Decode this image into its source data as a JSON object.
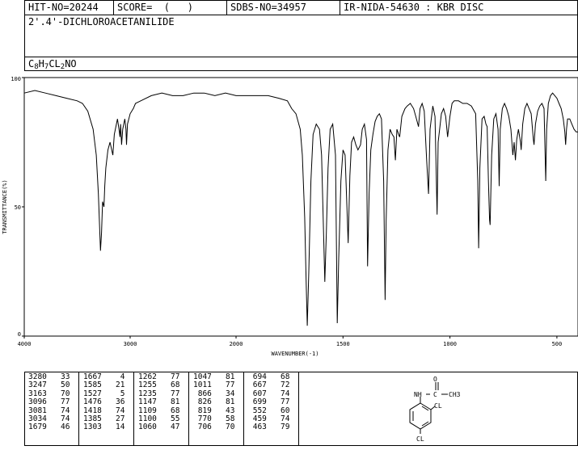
{
  "header": {
    "hit_no": "HIT-NO=20244",
    "score": "SCORE=  (   )",
    "sdbs_no": "SDBS-NO=34957",
    "ir_info": "IR-NIDA-54630 : KBR DISC",
    "compound_name": "2'.4'-DICHLOROACETANILIDE",
    "formula": {
      "c": "C",
      "c_n": "8",
      "h": "H",
      "h_n": "7",
      "cl": "CL",
      "cl_n": "2",
      "rest": "NO"
    }
  },
  "chart_data": {
    "type": "line",
    "xlabel": "WAVENUMBER(-1)",
    "ylabel": "TRANSMITTANCE(%)",
    "xlim": [
      4000,
      400
    ],
    "ylim": [
      0,
      100
    ],
    "x_ticks": [
      "4000",
      "3000",
      "2000",
      "1500",
      "1000",
      "500"
    ],
    "y_ticks": [
      "100",
      "50",
      "0"
    ],
    "series": [
      {
        "points": [
          [
            4000,
            94
          ],
          [
            3900,
            95
          ],
          [
            3800,
            94
          ],
          [
            3700,
            93
          ],
          [
            3600,
            92
          ],
          [
            3500,
            91
          ],
          [
            3450,
            90
          ],
          [
            3400,
            87
          ],
          [
            3350,
            80
          ],
          [
            3320,
            70
          ],
          [
            3300,
            55
          ],
          [
            3290,
            44
          ],
          [
            3280,
            33
          ],
          [
            3270,
            40
          ],
          [
            3260,
            52
          ],
          [
            3247,
            50
          ],
          [
            3240,
            58
          ],
          [
            3230,
            65
          ],
          [
            3210,
            72
          ],
          [
            3190,
            75
          ],
          [
            3163,
            70
          ],
          [
            3150,
            78
          ],
          [
            3130,
            82
          ],
          [
            3120,
            84
          ],
          [
            3105,
            80
          ],
          [
            3096,
            77
          ],
          [
            3090,
            82
          ],
          [
            3081,
            74
          ],
          [
            3070,
            80
          ],
          [
            3050,
            84
          ],
          [
            3040,
            80
          ],
          [
            3034,
            74
          ],
          [
            3025,
            82
          ],
          [
            3000,
            86
          ],
          [
            2970,
            88
          ],
          [
            2950,
            90
          ],
          [
            2900,
            91
          ],
          [
            2800,
            93
          ],
          [
            2700,
            94
          ],
          [
            2600,
            93
          ],
          [
            2500,
            93
          ],
          [
            2400,
            94
          ],
          [
            2300,
            94
          ],
          [
            2200,
            93
          ],
          [
            2100,
            94
          ],
          [
            2000,
            93
          ],
          [
            1950,
            93
          ],
          [
            1900,
            93
          ],
          [
            1850,
            93
          ],
          [
            1800,
            92
          ],
          [
            1760,
            91
          ],
          [
            1740,
            88
          ],
          [
            1720,
            86
          ],
          [
            1700,
            80
          ],
          [
            1690,
            70
          ],
          [
            1679,
            46
          ],
          [
            1672,
            20
          ],
          [
            1667,
            4
          ],
          [
            1660,
            25
          ],
          [
            1650,
            60
          ],
          [
            1640,
            78
          ],
          [
            1625,
            82
          ],
          [
            1610,
            80
          ],
          [
            1600,
            70
          ],
          [
            1585,
            21
          ],
          [
            1578,
            40
          ],
          [
            1570,
            65
          ],
          [
            1560,
            80
          ],
          [
            1548,
            82
          ],
          [
            1535,
            70
          ],
          [
            1527,
            5
          ],
          [
            1520,
            30
          ],
          [
            1510,
            60
          ],
          [
            1500,
            72
          ],
          [
            1490,
            70
          ],
          [
            1476,
            36
          ],
          [
            1468,
            62
          ],
          [
            1460,
            75
          ],
          [
            1450,
            77
          ],
          [
            1440,
            74
          ],
          [
            1430,
            72
          ],
          [
            1418,
            74
          ],
          [
            1410,
            80
          ],
          [
            1400,
            82
          ],
          [
            1390,
            76
          ],
          [
            1385,
            27
          ],
          [
            1378,
            55
          ],
          [
            1370,
            72
          ],
          [
            1360,
            78
          ],
          [
            1350,
            83
          ],
          [
            1340,
            85
          ],
          [
            1330,
            86
          ],
          [
            1320,
            84
          ],
          [
            1310,
            60
          ],
          [
            1303,
            14
          ],
          [
            1298,
            45
          ],
          [
            1290,
            72
          ],
          [
            1280,
            80
          ],
          [
            1270,
            78
          ],
          [
            1262,
            77
          ],
          [
            1255,
            68
          ],
          [
            1248,
            80
          ],
          [
            1240,
            78
          ],
          [
            1235,
            77
          ],
          [
            1225,
            85
          ],
          [
            1210,
            88
          ],
          [
            1200,
            89
          ],
          [
            1185,
            90
          ],
          [
            1170,
            88
          ],
          [
            1160,
            85
          ],
          [
            1147,
            81
          ],
          [
            1140,
            88
          ],
          [
            1130,
            90
          ],
          [
            1120,
            87
          ],
          [
            1109,
            68
          ],
          [
            1100,
            55
          ],
          [
            1093,
            80
          ],
          [
            1080,
            89
          ],
          [
            1070,
            85
          ],
          [
            1060,
            47
          ],
          [
            1055,
            75
          ],
          [
            1047,
            81
          ],
          [
            1040,
            86
          ],
          [
            1030,
            88
          ],
          [
            1020,
            85
          ],
          [
            1011,
            77
          ],
          [
            1000,
            85
          ],
          [
            990,
            90
          ],
          [
            980,
            91
          ],
          [
            960,
            91
          ],
          [
            940,
            90
          ],
          [
            920,
            90
          ],
          [
            900,
            89
          ],
          [
            880,
            86
          ],
          [
            870,
            60
          ],
          [
            866,
            34
          ],
          [
            860,
            65
          ],
          [
            850,
            84
          ],
          [
            840,
            85
          ],
          [
            832,
            82
          ],
          [
            826,
            81
          ],
          [
            820,
            60
          ],
          [
            815,
            45
          ],
          [
            812,
            43
          ],
          [
            805,
            70
          ],
          [
            795,
            84
          ],
          [
            785,
            86
          ],
          [
            775,
            80
          ],
          [
            770,
            58
          ],
          [
            765,
            80
          ],
          [
            755,
            88
          ],
          [
            745,
            90
          ],
          [
            735,
            88
          ],
          [
            725,
            85
          ],
          [
            715,
            80
          ],
          [
            706,
            70
          ],
          [
            700,
            75
          ],
          [
            694,
            68
          ],
          [
            688,
            76
          ],
          [
            680,
            80
          ],
          [
            670,
            75
          ],
          [
            667,
            72
          ],
          [
            660,
            82
          ],
          [
            650,
            88
          ],
          [
            640,
            90
          ],
          [
            630,
            88
          ],
          [
            620,
            86
          ],
          [
            610,
            76
          ],
          [
            607,
            74
          ],
          [
            600,
            82
          ],
          [
            590,
            87
          ],
          [
            580,
            89
          ],
          [
            570,
            90
          ],
          [
            560,
            88
          ],
          [
            552,
            60
          ],
          [
            548,
            80
          ],
          [
            540,
            90
          ],
          [
            530,
            93
          ],
          [
            520,
            94
          ],
          [
            510,
            93
          ],
          [
            500,
            92
          ],
          [
            490,
            90
          ],
          [
            480,
            88
          ],
          [
            470,
            84
          ],
          [
            463,
            79
          ],
          [
            459,
            74
          ],
          [
            455,
            80
          ],
          [
            450,
            84
          ],
          [
            440,
            84
          ],
          [
            430,
            82
          ],
          [
            420,
            80
          ],
          [
            410,
            79
          ],
          [
            400,
            79
          ]
        ]
      }
    ]
  },
  "peak_table": {
    "columns": [
      [
        [
          "3280",
          "33"
        ],
        [
          "3247",
          "50"
        ],
        [
          "3163",
          "70"
        ],
        [
          "3096",
          "77"
        ],
        [
          "3081",
          "74"
        ],
        [
          "3034",
          "74"
        ],
        [
          "1679",
          "46"
        ]
      ],
      [
        [
          "1667",
          "4"
        ],
        [
          "1585",
          "21"
        ],
        [
          "1527",
          "5"
        ],
        [
          "1476",
          "36"
        ],
        [
          "1418",
          "74"
        ],
        [
          "1385",
          "27"
        ],
        [
          "1303",
          "14"
        ]
      ],
      [
        [
          "1262",
          "77"
        ],
        [
          "1255",
          "68"
        ],
        [
          "1235",
          "77"
        ],
        [
          "1147",
          "81"
        ],
        [
          "1109",
          "68"
        ],
        [
          "1100",
          "55"
        ],
        [
          "1060",
          "47"
        ]
      ],
      [
        [
          "1047",
          "81"
        ],
        [
          "1011",
          "77"
        ],
        [
          "866",
          "34"
        ],
        [
          "826",
          "81"
        ],
        [
          "819",
          "43"
        ],
        [
          "770",
          "58"
        ],
        [
          "706",
          "70"
        ]
      ],
      [
        [
          "694",
          "68"
        ],
        [
          "667",
          "72"
        ],
        [
          "607",
          "74"
        ],
        [
          "699",
          "77"
        ],
        [
          "552",
          "60"
        ],
        [
          "459",
          "74"
        ],
        [
          "463",
          "79"
        ]
      ]
    ]
  },
  "structure": {
    "o_label": "O",
    "nh_label": "NH",
    "c_label": "C",
    "ch3_label": "CH3",
    "cl_top_label": "CL",
    "cl_bottom_label": "CL"
  }
}
